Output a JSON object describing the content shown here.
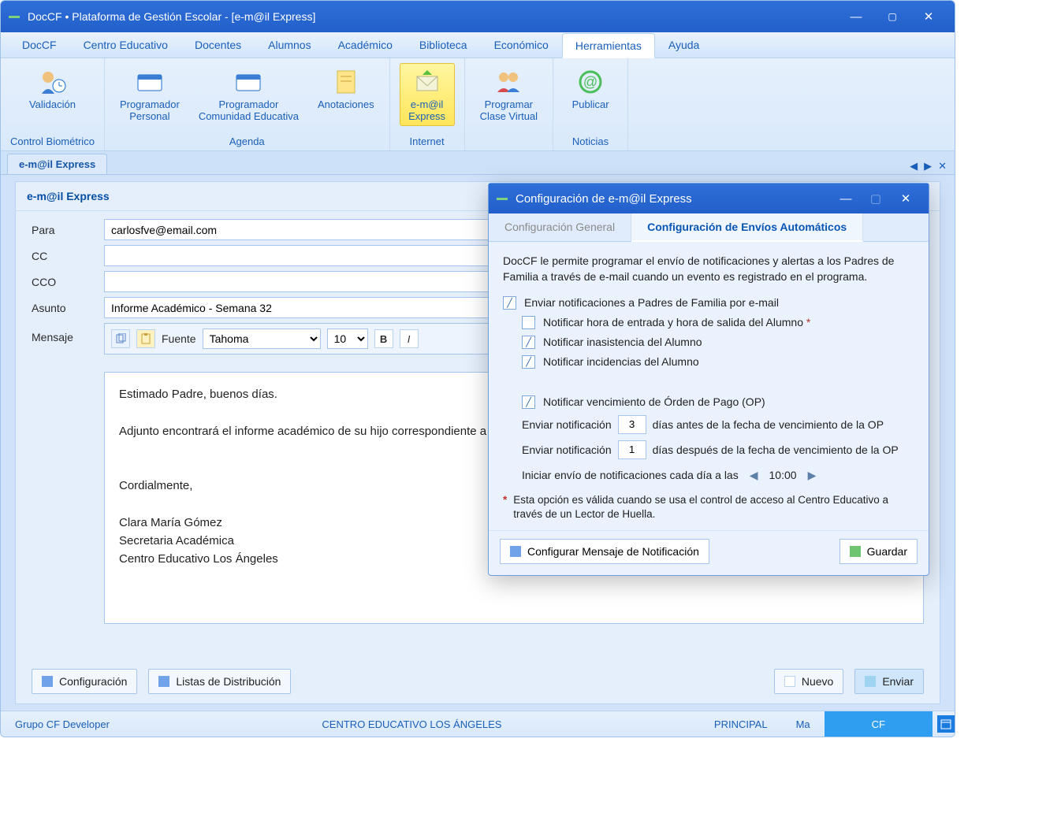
{
  "titlebar": {
    "text": "DocCF • Plataforma de Gestión Escolar  - [e-m@il Express]"
  },
  "menubar": [
    "DocCF",
    "Centro Educativo",
    "Docentes",
    "Alumnos",
    "Académico",
    "Biblioteca",
    "Económico",
    "Herramientas",
    "Ayuda"
  ],
  "menubar_active": 7,
  "ribbon": {
    "groups": [
      {
        "label": "Control Biométrico",
        "items": [
          {
            "label": "Validación",
            "icon": "user-clock"
          }
        ]
      },
      {
        "label": "Agenda",
        "items": [
          {
            "label": "Programador Personal",
            "icon": "card"
          },
          {
            "label": "Programador Comunidad Educativa",
            "icon": "card"
          },
          {
            "label": "Anotaciones",
            "icon": "note"
          }
        ]
      },
      {
        "label": "Internet",
        "items": [
          {
            "label": "e-m@il Express",
            "icon": "mail",
            "active": true
          }
        ]
      },
      {
        "label": "",
        "items": [
          {
            "label": "Programar Clase Virtual",
            "icon": "group"
          }
        ]
      },
      {
        "label": "Noticias",
        "items": [
          {
            "label": "Publicar",
            "icon": "at"
          }
        ]
      }
    ]
  },
  "tab": {
    "label": "e-m@il Express"
  },
  "panel": {
    "title": "e-m@il Express",
    "fields": {
      "para_label": "Para",
      "para_value": "carlosfve@email.com",
      "cc_label": "CC",
      "cc_value": "",
      "cco_label": "CCO",
      "cco_value": "",
      "asunto_label": "Asunto",
      "asunto_value": "Informe Académico - Semana 32",
      "mensaje_label": "Mensaje"
    },
    "toolbar": {
      "fuente_label": "Fuente",
      "font": "Tahoma",
      "size": "10",
      "bold": "B",
      "italic": "I"
    },
    "body": "Estimado Padre, buenos días.\n\nAdjunto encontrará el informe académico de su hijo correspondiente a la\n\n\nCordialmente,\n\nClara María Gómez\nSecretaria Académica\nCentro Educativo Los Ángeles",
    "buttons": {
      "config": "Configuración",
      "listas": "Listas de Distribución",
      "nuevo": "Nuevo",
      "enviar": "Enviar"
    }
  },
  "dialog": {
    "title": "Configuración de e-m@il Express",
    "tabs": [
      "Configuración General",
      "Configuración de Envíos Automáticos"
    ],
    "tabs_active": 1,
    "desc": "DocCF le permite programar el envío de notificaciones y alertas a los Padres de Familia a través de e-mail cuando un evento es registrado en el programa.",
    "chk_main": "Enviar notificaciones a Padres de Familia por e-mail",
    "chk_entry": "Notificar hora de entrada y hora de salida del Alumno ",
    "chk_absence": "Notificar inasistencia del Alumno",
    "chk_incident": "Notificar incidencias del Alumno",
    "chk_payment": "Notificar vencimiento de Órden de Pago (OP)",
    "before_label_a": "Enviar notificación",
    "before_days": "3",
    "before_label_b": "días antes de la fecha de vencimiento de la OP",
    "after_label_a": "Enviar notificación",
    "after_days": "1",
    "after_label_b": "días después de la fecha de vencimiento de la OP",
    "time_label": "Iniciar envío de notificaciones cada día a las",
    "time_value": "10:00",
    "note": "Esta opción es válida cuando se usa el control de acceso al Centro Educativo a través de un Lector de Huella.",
    "btn_config": "Configurar Mensaje de Notificación",
    "btn_save": "Guardar"
  },
  "status": {
    "left": "Grupo CF Developer",
    "center": "CENTRO EDUCATIVO LOS ÁNGELES",
    "user": "PRINCIPAL",
    "day": "Ma",
    "right": "CF"
  },
  "colors": {
    "sq_blue": "#6fa2e8",
    "sq_blue2": "#4f8be0",
    "sq_white": "#ffffff",
    "sq_cyan": "#9dd3f0",
    "sq_green": "#6fc56f"
  }
}
